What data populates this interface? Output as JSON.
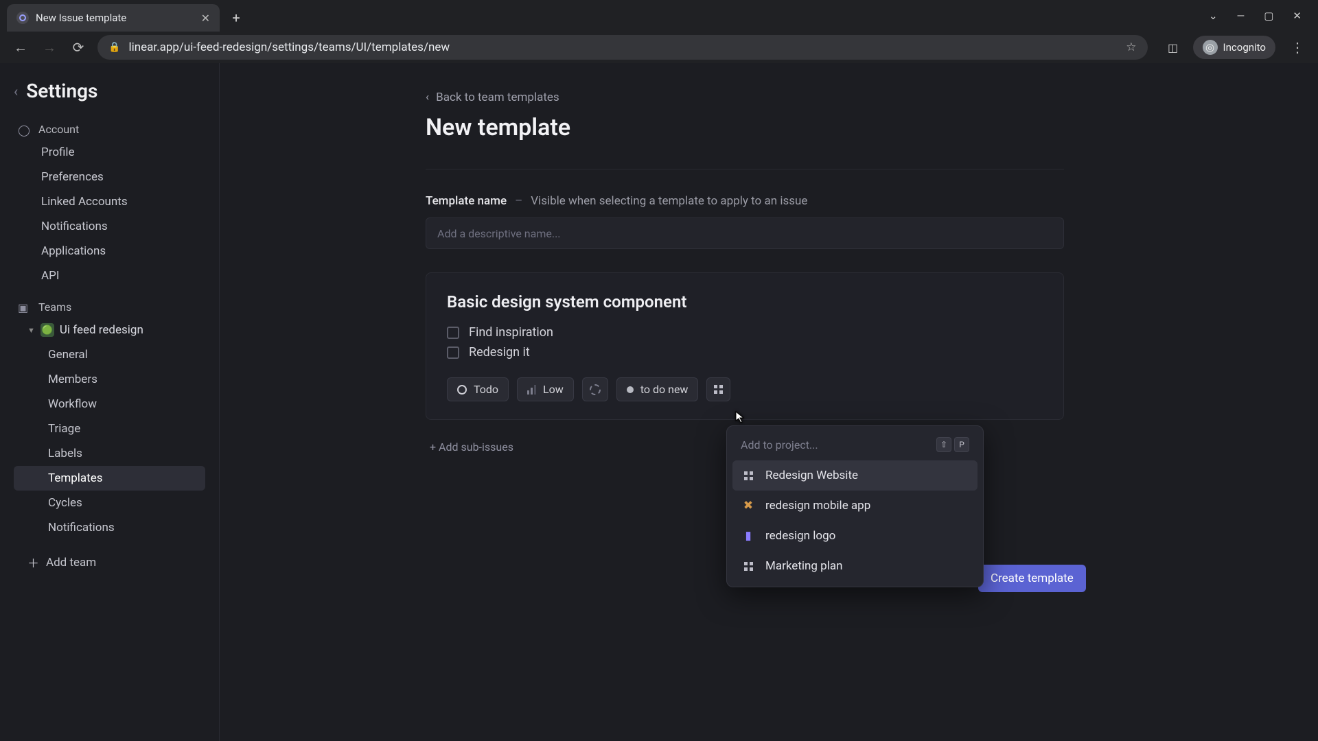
{
  "browser": {
    "tab_title": "New Issue template",
    "url": "linear.app/ui-feed-redesign/settings/teams/UI/templates/new",
    "incognito_label": "Incognito"
  },
  "sidebar": {
    "title": "Settings",
    "account_label": "Account",
    "account_items": [
      "Profile",
      "Preferences",
      "Linked Accounts",
      "Notifications",
      "Applications",
      "API"
    ],
    "teams_label": "Teams",
    "team_name": "Ui feed redesign",
    "team_items": [
      "General",
      "Members",
      "Workflow",
      "Triage",
      "Labels",
      "Templates",
      "Cycles",
      "Notifications"
    ],
    "team_active_index": 5,
    "add_team_label": "Add team"
  },
  "main": {
    "back_label": "Back to team templates",
    "title": "New template",
    "field_label": "Template name",
    "field_hint": "Visible when selecting a template to apply to an issue",
    "name_placeholder": "Add a descriptive name...",
    "card_title": "Basic design system component",
    "checklist": [
      "Find inspiration",
      "Redesign it"
    ],
    "chips": {
      "status": "Todo",
      "priority": "Low",
      "label": "to do new"
    },
    "add_sub_issues": "+ Add sub-issues",
    "create_button": "Create template"
  },
  "popover": {
    "placeholder": "Add to project...",
    "shortcut": [
      "⇧",
      "P"
    ],
    "items": [
      {
        "label": "Redesign Website",
        "icon": "grid",
        "highlight": true
      },
      {
        "label": "redesign mobile app",
        "icon": "tools"
      },
      {
        "label": "redesign logo",
        "icon": "doc"
      },
      {
        "label": "Marketing plan",
        "icon": "grid"
      }
    ]
  }
}
